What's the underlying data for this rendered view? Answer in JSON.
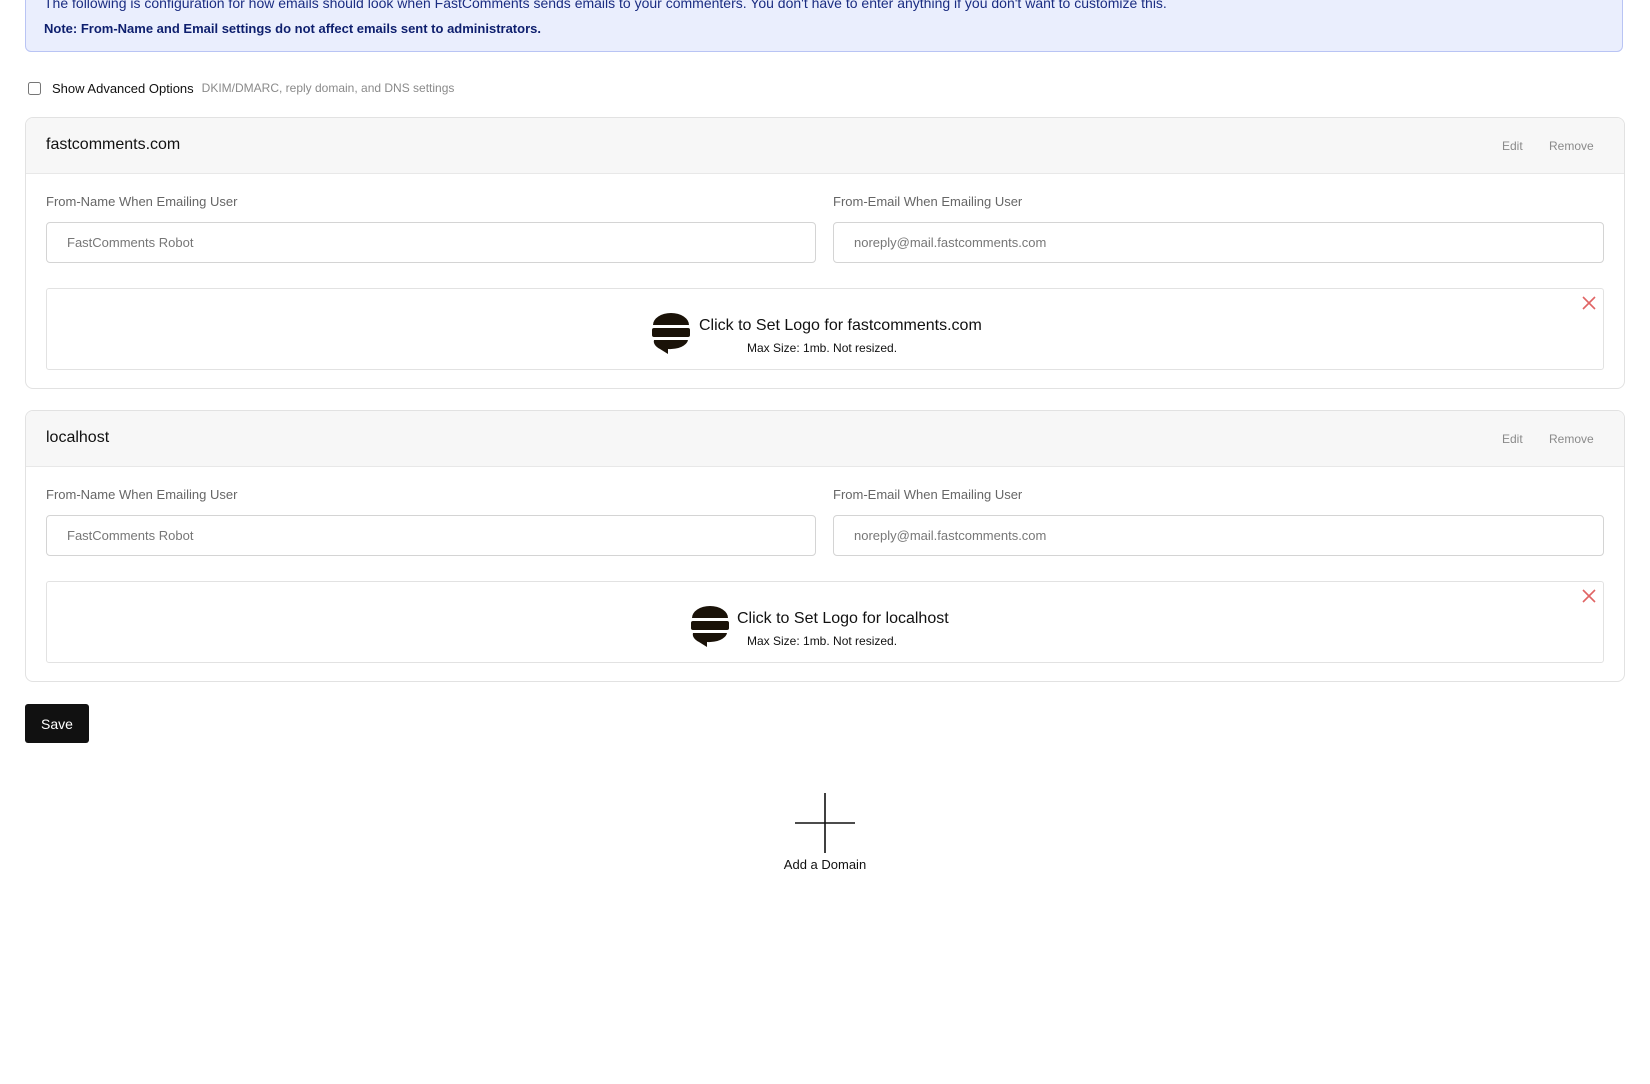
{
  "info": {
    "line1": "The following is configuration for how emails should look when FastComments sends emails to your commenters. You don't have to enter anything if you don't want to customize this.",
    "note": "Note: From-Name and Email settings do not affect emails sent to administrators."
  },
  "advanced": {
    "label": "Show Advanced Options",
    "hint": "DKIM/DMARC, reply domain, and DNS settings",
    "checked": false
  },
  "domains": [
    {
      "name": "fastcomments.com",
      "edit_label": "Edit",
      "remove_label": "Remove",
      "from_name_label": "From-Name When Emailing User",
      "from_name_placeholder": "FastComments Robot",
      "from_email_label": "From-Email When Emailing User",
      "from_email_placeholder": "noreply@mail.fastcomments.com",
      "logo_title": "Click to Set Logo for fastcomments.com",
      "logo_sub": "Max Size: 1mb. Not resized."
    },
    {
      "name": "localhost",
      "edit_label": "Edit",
      "remove_label": "Remove",
      "from_name_label": "From-Name When Emailing User",
      "from_name_placeholder": "FastComments Robot",
      "from_email_label": "From-Email When Emailing User",
      "from_email_placeholder": "noreply@mail.fastcomments.com",
      "logo_title": "Click to Set Logo for localhost",
      "logo_sub": "Max Size: 1mb. Not resized."
    }
  ],
  "save_label": "Save",
  "add_domain_label": "Add a Domain",
  "icons": {
    "logo": "fastcomments-logo-icon",
    "close": "close-icon",
    "add": "plus-icon"
  },
  "colors": {
    "info_bg": "#eaeefd",
    "info_border": "#b9c4f4",
    "info_text": "#1b2d82",
    "close_icon": "#e06464",
    "save_bg": "#111111"
  }
}
